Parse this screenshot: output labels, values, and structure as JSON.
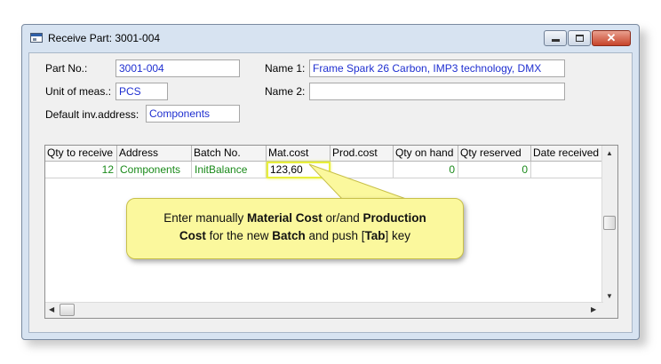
{
  "window": {
    "title": "Receive Part: 3001-004",
    "close_glyph": "✕"
  },
  "form": {
    "part_no_label": "Part No.:",
    "part_no_value": "3001-004",
    "unit_label": "Unit of meas.:",
    "unit_value": "PCS",
    "inv_label": "Default inv.address:",
    "inv_value": "Components",
    "name1_label": "Name 1:",
    "name1_value": "Frame Spark 26 Carbon, IMP3 technology, DMX",
    "name2_label": "Name 2:",
    "name2_value": ""
  },
  "grid": {
    "columns": [
      "Qty to receive",
      "Address",
      "Batch No.",
      "Mat.cost",
      "Prod.cost",
      "Qty on hand",
      "Qty reserved",
      "Date received"
    ],
    "row": {
      "qty_to_receive": "12",
      "address": "Components",
      "batch_no": "InitBalance",
      "mat_cost": "123,60",
      "prod_cost": "",
      "qty_on_hand": "0",
      "qty_reserved": "0",
      "date_received": ""
    }
  },
  "callout": {
    "t1": "Enter manually ",
    "b1": "Material Cost",
    "t2": " or/and ",
    "b2": "Production",
    "b3": "Cost",
    "t3": " for the new ",
    "b4": "Batch",
    "t4": " and push [",
    "b5": "Tab",
    "t5": "] key"
  },
  "colors": {
    "field_text": "#1f2fd0",
    "grid_text": "#1a8a1a",
    "callout_bg": "#fbf89d",
    "highlight": "#e8ef3d"
  }
}
